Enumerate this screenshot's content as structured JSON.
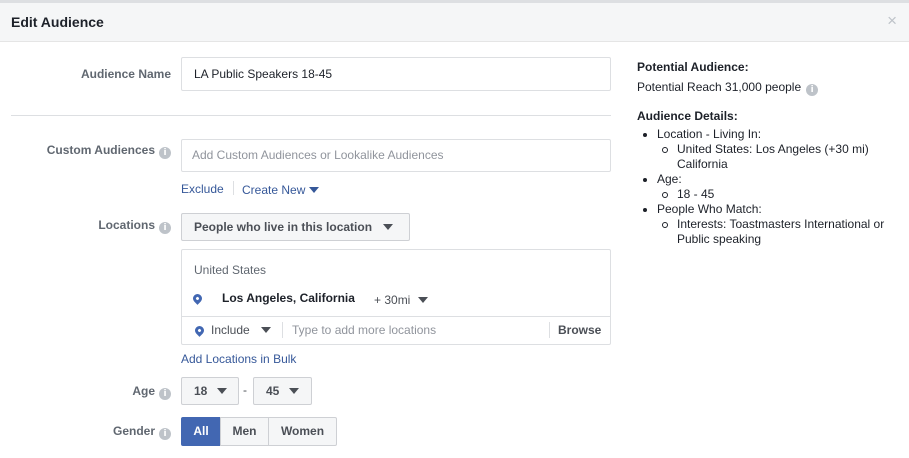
{
  "dialog": {
    "title": "Edit Audience",
    "close_symbol": "×"
  },
  "audience_name": {
    "label": "Audience Name",
    "value": "LA Public Speakers 18-45"
  },
  "custom_audiences": {
    "label": "Custom Audiences",
    "placeholder": "Add Custom Audiences or Lookalike Audiences",
    "exclude_link": "Exclude",
    "create_new_link": "Create New"
  },
  "locations": {
    "label": "Locations",
    "type_dropdown": "People who live in this location",
    "country": "United States",
    "city": "Los Angeles, California",
    "radius": "+ 30mi",
    "include_dropdown": "Include",
    "search_placeholder": "Type to add more locations",
    "browse_button": "Browse",
    "bulk_link": "Add Locations in Bulk"
  },
  "age": {
    "label": "Age",
    "min": "18",
    "separator": "-",
    "max": "45"
  },
  "gender": {
    "label": "Gender",
    "options": [
      "All",
      "Men",
      "Women"
    ],
    "selected": "All"
  },
  "summary": {
    "potential_heading": "Potential Audience:",
    "potential_reach": "Potential Reach 31,000 people",
    "details_heading": "Audience Details:",
    "details": [
      {
        "label": "Location - Living In:",
        "items": [
          "United States: Los Angeles (+30 mi) California"
        ]
      },
      {
        "label": "Age:",
        "items": [
          "18 - 45"
        ]
      },
      {
        "label": "People Who Match:",
        "items": [
          "Interests: Toastmasters International or Public speaking"
        ]
      }
    ]
  },
  "icons": {
    "info": "info-icon",
    "close": "close-icon",
    "pin": "location-pin-icon",
    "caret": "caret-down-icon"
  },
  "colors": {
    "accent": "#4267b2",
    "link": "#365899",
    "header_bg": "#f5f6f7"
  }
}
